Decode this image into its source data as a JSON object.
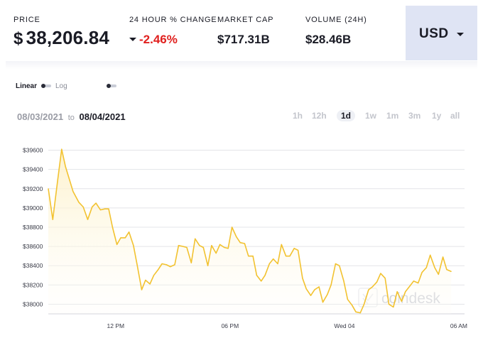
{
  "stats": {
    "price_label": "PRICE",
    "price_currency_symbol": "$",
    "price_value": "38,206.84",
    "change_label": "24 HOUR % CHANGE",
    "change_value": "-2.46%",
    "market_cap_label": "MARKET CAP",
    "market_cap_value": "$717.31B",
    "volume_label": "VOLUME (24H)",
    "volume_value": "$28.46B"
  },
  "currency": {
    "selected": "USD",
    "icon": "chevron-down-icon"
  },
  "scale": {
    "linear_label": "Linear",
    "log_label": "Log",
    "selected": "Linear"
  },
  "date_range": {
    "from": "08/03/2021",
    "to_word": "to",
    "to": "08/04/2021"
  },
  "ranges": [
    {
      "label": "1h",
      "active": false
    },
    {
      "label": "12h",
      "active": false
    },
    {
      "label": "1d",
      "active": true
    },
    {
      "label": "1w",
      "active": false
    },
    {
      "label": "1m",
      "active": false
    },
    {
      "label": "3m",
      "active": false
    },
    {
      "label": "1y",
      "active": false
    },
    {
      "label": "all",
      "active": false
    }
  ],
  "watermark": "coindesk",
  "colors": {
    "line": "#f2c230",
    "area_top": "#fdf1c9",
    "negative": "#e0201e",
    "currency_bg": "#dfe4f4",
    "grid": "#e3e4e8"
  },
  "chart_data": {
    "type": "area",
    "ylim": [
      37900,
      39700
    ],
    "y_ticks": [
      38000,
      38200,
      38400,
      38600,
      38800,
      39000,
      39200,
      39400,
      39600
    ],
    "y_tick_labels": [
      "$38000",
      "$38200",
      "$38400",
      "$38600",
      "$38800",
      "$39000",
      "$39200",
      "$39400",
      "$39600"
    ],
    "x_tick_labels": [
      {
        "label": "12 PM",
        "x": 13
      },
      {
        "label": "06 PM",
        "x": 31
      },
      {
        "label": "Wed 04",
        "x": 49
      },
      {
        "label": "06 AM",
        "x": 67
      }
    ],
    "x_unit": "hours from 2021-08-03 00:00",
    "grid": true,
    "legend": "none",
    "points": [
      [
        2.4,
        39200
      ],
      [
        3.1,
        38880
      ],
      [
        3.9,
        39300
      ],
      [
        4.5,
        39610
      ],
      [
        5.1,
        39430
      ],
      [
        6.3,
        39170
      ],
      [
        7.2,
        39060
      ],
      [
        7.9,
        39010
      ],
      [
        8.6,
        38880
      ],
      [
        9.3,
        39010
      ],
      [
        9.9,
        39050
      ],
      [
        10.6,
        38980
      ],
      [
        11.3,
        38990
      ],
      [
        11.9,
        38990
      ],
      [
        12.5,
        38800
      ],
      [
        13.2,
        38620
      ],
      [
        13.8,
        38690
      ],
      [
        14.5,
        38690
      ],
      [
        15.1,
        38750
      ],
      [
        15.8,
        38610
      ],
      [
        16.4,
        38400
      ],
      [
        17.1,
        38150
      ],
      [
        17.7,
        38250
      ],
      [
        18.4,
        38210
      ],
      [
        19.0,
        38300
      ],
      [
        19.7,
        38360
      ],
      [
        20.3,
        38420
      ],
      [
        21.0,
        38410
      ],
      [
        21.6,
        38390
      ],
      [
        22.3,
        38410
      ],
      [
        22.9,
        38610
      ],
      [
        23.6,
        38600
      ],
      [
        24.2,
        38590
      ],
      [
        24.9,
        38430
      ],
      [
        25.5,
        38680
      ],
      [
        26.2,
        38610
      ],
      [
        26.8,
        38590
      ],
      [
        27.5,
        38400
      ],
      [
        28.1,
        38610
      ],
      [
        28.8,
        38530
      ],
      [
        29.4,
        38620
      ],
      [
        30.1,
        38590
      ],
      [
        30.7,
        38580
      ],
      [
        31.3,
        38800
      ],
      [
        32.0,
        38700
      ],
      [
        32.6,
        38640
      ],
      [
        33.3,
        38630
      ],
      [
        33.9,
        38500
      ],
      [
        34.6,
        38500
      ],
      [
        35.2,
        38300
      ],
      [
        35.9,
        38240
      ],
      [
        36.5,
        38300
      ],
      [
        37.2,
        38420
      ],
      [
        37.8,
        38470
      ],
      [
        38.5,
        38420
      ],
      [
        39.1,
        38620
      ],
      [
        39.8,
        38500
      ],
      [
        40.4,
        38500
      ],
      [
        41.1,
        38580
      ],
      [
        41.7,
        38560
      ],
      [
        42.4,
        38270
      ],
      [
        43.0,
        38160
      ],
      [
        43.7,
        38090
      ],
      [
        44.3,
        38150
      ],
      [
        45.0,
        38180
      ],
      [
        45.6,
        38020
      ],
      [
        46.3,
        38100
      ],
      [
        46.9,
        38200
      ],
      [
        47.6,
        38420
      ],
      [
        48.2,
        38400
      ],
      [
        48.9,
        38240
      ],
      [
        49.5,
        38050
      ],
      [
        50.2,
        37990
      ],
      [
        50.8,
        37920
      ],
      [
        51.5,
        37910
      ],
      [
        52.1,
        38000
      ],
      [
        52.8,
        38150
      ],
      [
        53.4,
        38180
      ],
      [
        54.1,
        38230
      ],
      [
        54.7,
        38320
      ],
      [
        55.4,
        38270
      ],
      [
        56.0,
        38000
      ],
      [
        56.7,
        37970
      ],
      [
        57.3,
        38130
      ],
      [
        58.0,
        38030
      ],
      [
        58.6,
        38130
      ],
      [
        59.3,
        38190
      ],
      [
        59.9,
        38240
      ],
      [
        60.6,
        38220
      ],
      [
        61.2,
        38330
      ],
      [
        61.9,
        38380
      ],
      [
        62.5,
        38510
      ],
      [
        63.2,
        38380
      ],
      [
        63.8,
        38310
      ],
      [
        64.5,
        38490
      ],
      [
        65.1,
        38360
      ],
      [
        65.8,
        38340
      ]
    ]
  }
}
